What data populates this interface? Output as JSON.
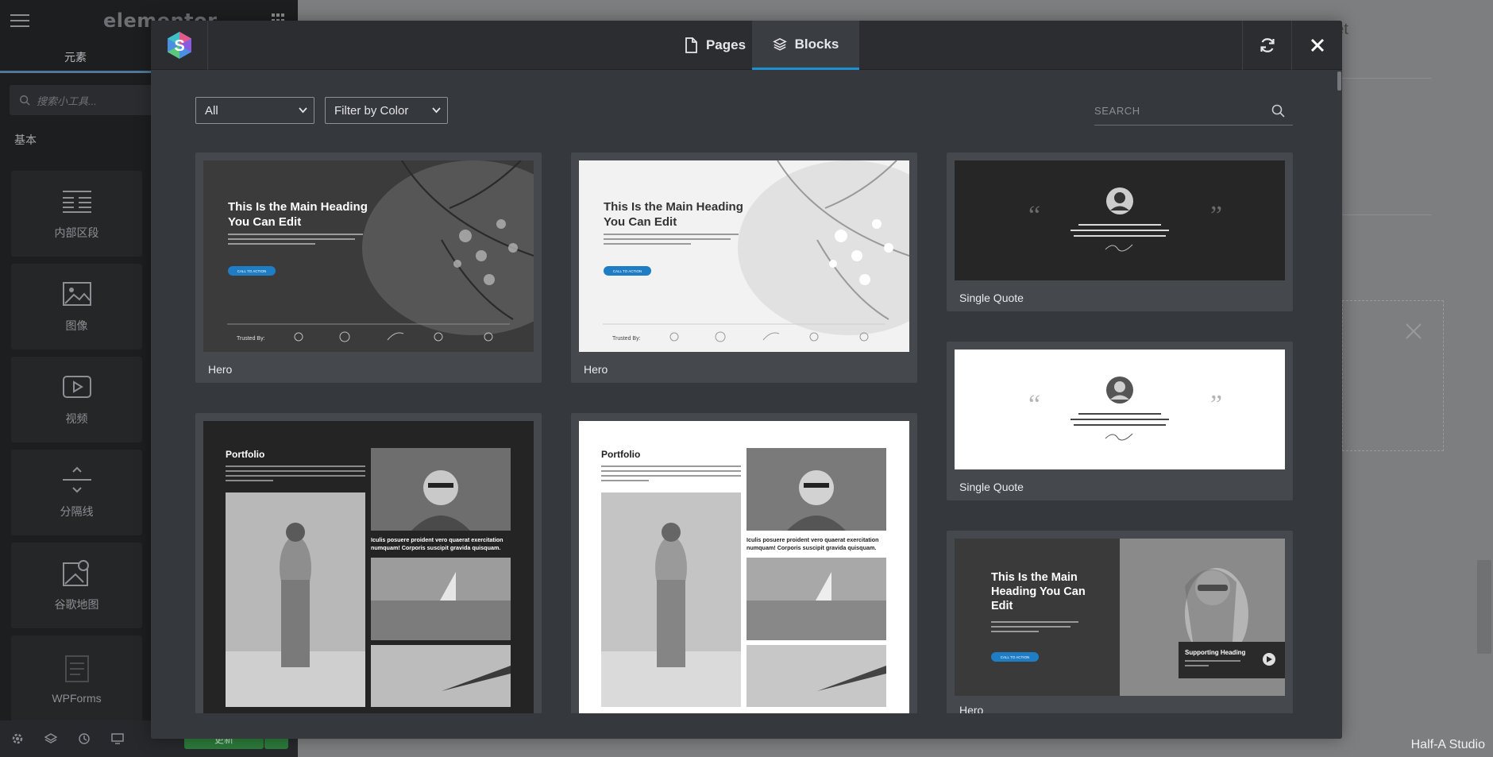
{
  "editor": {
    "logo": "elementor",
    "tab_elements": "元素",
    "search_placeholder": "搜索小工具...",
    "category": "基本",
    "widgets": [
      "内部区段",
      "图像",
      "视频",
      "分隔线",
      "谷歌地图",
      "WPForms"
    ],
    "update_button": "更新",
    "preview_text": "net"
  },
  "modal": {
    "tabs": {
      "pages": "Pages",
      "blocks": "Blocks"
    },
    "filters": {
      "category": "All",
      "color": "Filter by Color"
    },
    "search_placeholder": "SEARCH",
    "accent_color": "#1e8fcf",
    "cards": [
      {
        "label": "Hero",
        "theme": "dark",
        "heading_line1": "This Is the Main Heading",
        "heading_line2": "You Can Edit",
        "cta": "CALL TO ACTION",
        "trusted": "Trusted By:"
      },
      {
        "label": "Hero",
        "theme": "light",
        "heading_line1": "This Is the Main Heading",
        "heading_line2": "You Can Edit",
        "cta": "CALL TO ACTION",
        "trusted": "Trusted By:"
      },
      {
        "label": "Single Quote",
        "theme": "dark"
      },
      {
        "label": "Single Quote",
        "theme": "light"
      },
      {
        "label": "",
        "theme": "dark",
        "title": "Portfolio",
        "caption_line1": "Iculis posuere proident vero quaerat exercitation",
        "caption_line2": "numquam! Corporis suscipit gravida quisquam."
      },
      {
        "label": "",
        "theme": "light",
        "title": "Portfolio",
        "caption_line1": "Iculis posuere proident vero quaerat exercitation",
        "caption_line2": "numquam! Corporis suscipit gravida quisquam."
      },
      {
        "label": "Hero",
        "theme": "split",
        "heading_line1": "This Is the Main",
        "heading_line2": "Heading You Can",
        "heading_line3": "Edit",
        "cta": "CALL TO ACTION",
        "supporting": "Supporting Heading"
      }
    ]
  },
  "watermark": "Half-A Studio"
}
